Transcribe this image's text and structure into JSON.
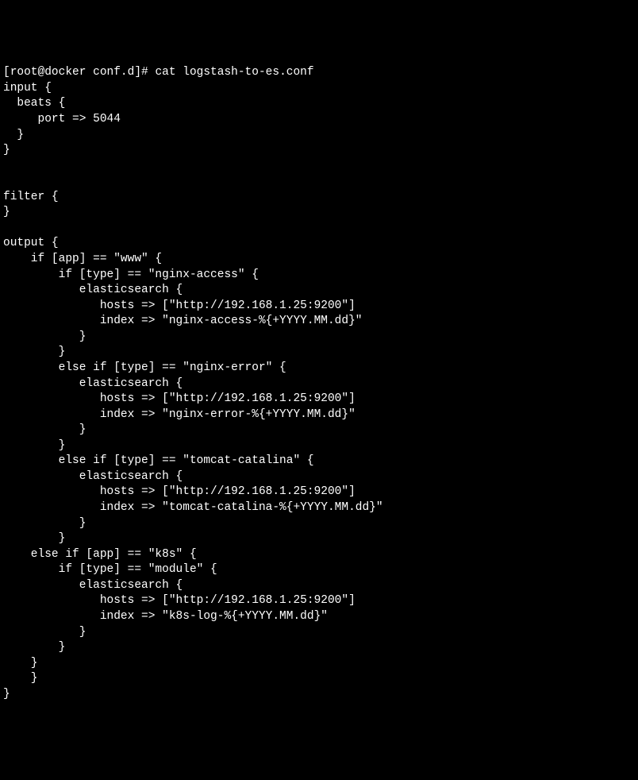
{
  "terminal": {
    "prompt": "[root@docker conf.d]# ",
    "command": "cat logstash-to-es.conf",
    "lines": [
      "input {",
      "  beats {",
      "     port => 5044",
      "  }",
      "}",
      "",
      "",
      "filter {",
      "}",
      "",
      "output {",
      "    if [app] == \"www\" {",
      "        if [type] == \"nginx-access\" {",
      "           elasticsearch {",
      "              hosts => [\"http://192.168.1.25:9200\"]",
      "              index => \"nginx-access-%{+YYYY.MM.dd}\"",
      "           }",
      "        }",
      "        else if [type] == \"nginx-error\" {",
      "           elasticsearch {",
      "              hosts => [\"http://192.168.1.25:9200\"]",
      "              index => \"nginx-error-%{+YYYY.MM.dd}\"",
      "           }",
      "        }",
      "        else if [type] == \"tomcat-catalina\" {",
      "           elasticsearch {",
      "              hosts => [\"http://192.168.1.25:9200\"]",
      "              index => \"tomcat-catalina-%{+YYYY.MM.dd}\"",
      "           }",
      "        }",
      "    else if [app] == \"k8s\" {",
      "        if [type] == \"module\" {",
      "           elasticsearch {",
      "              hosts => [\"http://192.168.1.25:9200\"]",
      "              index => \"k8s-log-%{+YYYY.MM.dd}\"",
      "           }",
      "        }",
      "    }",
      "    }",
      "}"
    ]
  }
}
